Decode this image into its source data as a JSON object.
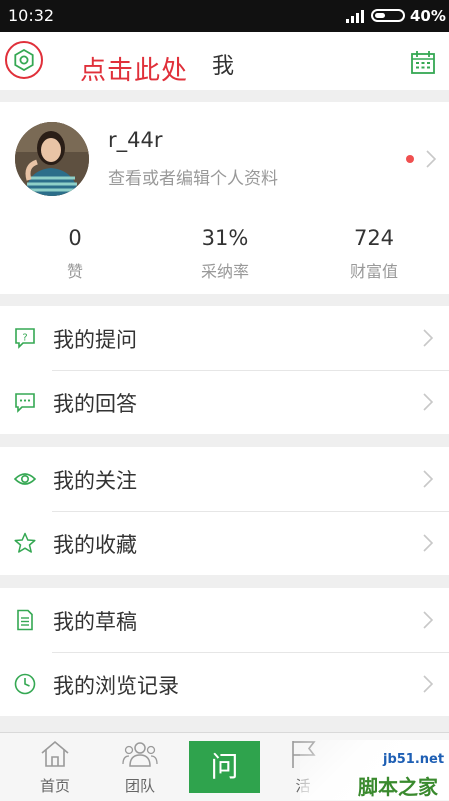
{
  "status_bar": {
    "time": "10:32",
    "battery_text": "40%",
    "battery_level": 0.4
  },
  "header": {
    "title": "我",
    "annotation": "点击此处"
  },
  "profile": {
    "username": "r_44r",
    "subtitle": "查看或者编辑个人资料",
    "has_notification": true
  },
  "stats": [
    {
      "value": "0",
      "label": "赞"
    },
    {
      "value": "31%",
      "label": "采纳率"
    },
    {
      "value": "724",
      "label": "财富值"
    }
  ],
  "menu": {
    "group1": [
      {
        "label": "我的提问",
        "icon": "question-bubble-icon"
      },
      {
        "label": "我的回答",
        "icon": "answer-bubble-icon"
      }
    ],
    "group2": [
      {
        "label": "我的关注",
        "icon": "eye-icon"
      },
      {
        "label": "我的收藏",
        "icon": "star-icon"
      }
    ],
    "group3": [
      {
        "label": "我的草稿",
        "icon": "document-icon"
      },
      {
        "label": "我的浏览记录",
        "icon": "clock-icon"
      }
    ]
  },
  "bottom_nav": {
    "home": "首页",
    "team": "团队",
    "ask": "问",
    "activity": "活"
  },
  "watermark": {
    "url": "jb51.net",
    "name": "脚本之家"
  },
  "colors": {
    "accent": "#2fa34d",
    "annotation": "#e0303a",
    "icon_green": "#35a853"
  }
}
